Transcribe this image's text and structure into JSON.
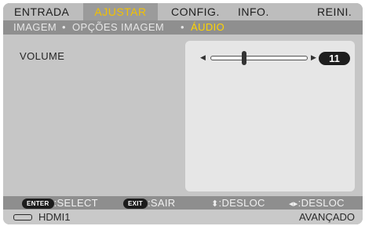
{
  "tabs": [
    {
      "label": "ENTRADA",
      "active": false
    },
    {
      "label": "AJUSTAR",
      "active": true
    },
    {
      "label": "CONFIG.",
      "active": false
    },
    {
      "label": "INFO.",
      "active": false
    },
    {
      "label": "REINI.",
      "active": false
    }
  ],
  "breadcrumb": {
    "items": [
      "IMAGEM",
      "OPÇÕES IMAGEM",
      "ÁUDIO"
    ],
    "separator": "•",
    "active_index": 2
  },
  "volume": {
    "label": "VOLUME",
    "value": "11",
    "slider_fraction": 0.35
  },
  "helpbar": {
    "enter_key": "ENTER",
    "enter_text": ":SELECT",
    "exit_key": "EXIT",
    "exit_text": ":SAIR",
    "updown_text": ":DESLOC",
    "leftright_text": ":DESLOC"
  },
  "status": {
    "source": "HDMI1",
    "mode": "AVANÇADO"
  },
  "colors": {
    "accent": "#f2c100",
    "active_crumb": "#ffd400"
  }
}
